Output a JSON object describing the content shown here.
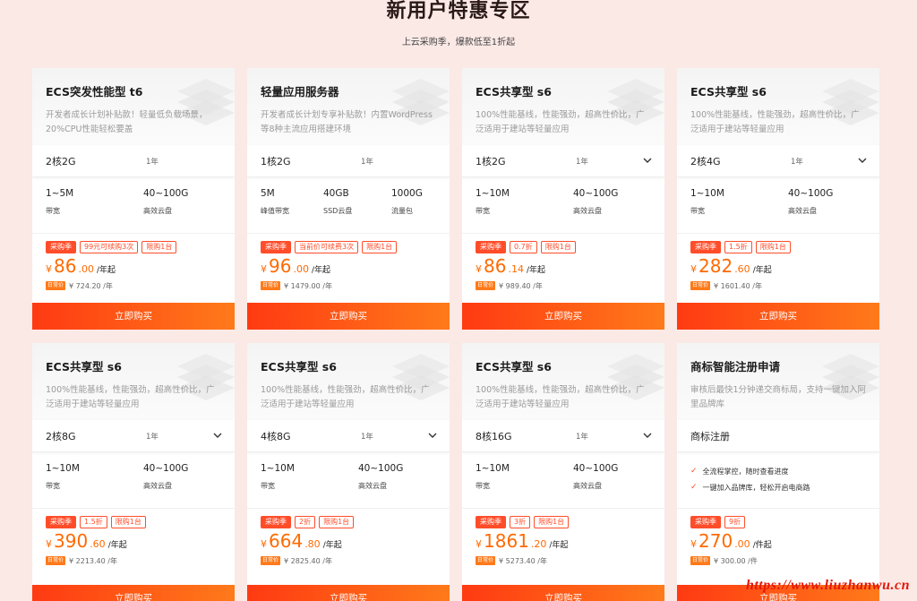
{
  "header": {
    "title": "新用户特惠专区",
    "subtitle": "上云采购季，爆款低至1折起"
  },
  "cards": [
    {
      "name": "ECS突发性能型 t6",
      "desc": "开发者成长计划补贴款！轻量低负载场景，20%CPU性能轻松要盖",
      "spec": "2核2G",
      "duration": "1年",
      "features": [
        {
          "v": "1~5M",
          "l": "带宽"
        },
        {
          "v": "40~100G",
          "l": "高效云盘"
        }
      ],
      "tag1": "采购季",
      "tag2": "99元可续购3次",
      "tag3": "限购1台",
      "yen": "¥",
      "int": "86",
      "dec": ".00",
      "unit": "/年起",
      "badge": "日常价",
      "orig": "¥ 724.20 /年",
      "buy": "立即购买"
    },
    {
      "name": "轻量应用服务器",
      "desc": "开发者成长计划专享补贴款！内置WordPress等8种主流应用搭建环境",
      "spec": "1核2G",
      "duration": "1年",
      "features": [
        {
          "v": "5M",
          "l": "峰值带宽"
        },
        {
          "v": "40GB",
          "l": "SSD云盘"
        },
        {
          "v": "1000G",
          "l": "流量包"
        }
      ],
      "tag1": "采购季",
      "tag2": "当前价可续费3次",
      "tag3": "限购1台",
      "yen": "¥",
      "int": "96",
      "dec": ".00",
      "unit": "/年起",
      "badge": "日常价",
      "orig": "¥ 1479.00 /年",
      "buy": "立即购买"
    },
    {
      "name": "ECS共享型 s6",
      "desc": "100%性能基线，性能强劲，超高性价比，广泛适用于建站等轻量应用",
      "spec": "1核2G",
      "duration": "1年",
      "features": [
        {
          "v": "1~10M",
          "l": "带宽"
        },
        {
          "v": "40~100G",
          "l": "高效云盘"
        }
      ],
      "tag1": "采购季",
      "tag2": "0.7折",
      "tag3": "限购1台",
      "yen": "¥",
      "int": "86",
      "dec": ".14",
      "unit": "/年起",
      "badge": "日常价",
      "orig": "¥ 989.40 /年",
      "buy": "立即购买"
    },
    {
      "name": "ECS共享型 s6",
      "desc": "100%性能基线，性能强劲，超高性价比，广泛适用于建站等轻量应用",
      "spec": "2核4G",
      "duration": "1年",
      "features": [
        {
          "v": "1~10M",
          "l": "带宽"
        },
        {
          "v": "40~100G",
          "l": "高效云盘"
        }
      ],
      "tag1": "采购季",
      "tag2": "1.5折",
      "tag3": "限购1台",
      "yen": "¥",
      "int": "282",
      "dec": ".60",
      "unit": "/年起",
      "badge": "日常价",
      "orig": "¥ 1601.40 /年",
      "buy": "立即购买"
    },
    {
      "name": "ECS共享型 s6",
      "desc": "100%性能基线，性能强劲，超高性价比，广泛适用于建站等轻量应用",
      "spec": "2核8G",
      "duration": "1年",
      "features": [
        {
          "v": "1~10M",
          "l": "带宽"
        },
        {
          "v": "40~100G",
          "l": "高效云盘"
        }
      ],
      "tag1": "采购季",
      "tag2": "1.5折",
      "tag3": "限购1台",
      "yen": "¥",
      "int": "390",
      "dec": ".60",
      "unit": "/年起",
      "badge": "日常价",
      "orig": "¥ 2213.40 /年",
      "buy": "立即购买"
    },
    {
      "name": "ECS共享型 s6",
      "desc": "100%性能基线，性能强劲，超高性价比，广泛适用于建站等轻量应用",
      "spec": "4核8G",
      "duration": "1年",
      "features": [
        {
          "v": "1~10M",
          "l": "带宽"
        },
        {
          "v": "40~100G",
          "l": "高效云盘"
        }
      ],
      "tag1": "采购季",
      "tag2": "2折",
      "tag3": "限购1台",
      "yen": "¥",
      "int": "664",
      "dec": ".80",
      "unit": "/年起",
      "badge": "日常价",
      "orig": "¥ 2825.40 /年",
      "buy": "立即购买"
    },
    {
      "name": "ECS共享型 s6",
      "desc": "100%性能基线，性能强劲，超高性价比，广泛适用于建站等轻量应用",
      "spec": "8核16G",
      "duration": "1年",
      "features": [
        {
          "v": "1~10M",
          "l": "带宽"
        },
        {
          "v": "40~100G",
          "l": "高效云盘"
        }
      ],
      "tag1": "采购季",
      "tag2": "3折",
      "tag3": "限购1台",
      "yen": "¥",
      "int": "1861",
      "dec": ".20",
      "unit": "/年起",
      "badge": "日常价",
      "orig": "¥ 5273.40 /年",
      "buy": "立即购买"
    },
    {
      "name": "商标智能注册申请",
      "desc": "审核后最快1分钟递交商标局，支持一键加入阿里品牌库",
      "spec": "商标注册",
      "bullets": [
        "全流程掌控，随时查看进度",
        "一键加入品牌库，轻松开启电商路"
      ],
      "tag1": "采购季",
      "tag2": "9折",
      "yen": "¥",
      "int": "270",
      "dec": ".00",
      "unit": "/件起",
      "badge": "日常价",
      "orig": "¥ 300.00 /件",
      "buy": "立即购买"
    }
  ],
  "watermark": "https://www.liuzhanwu.cn"
}
